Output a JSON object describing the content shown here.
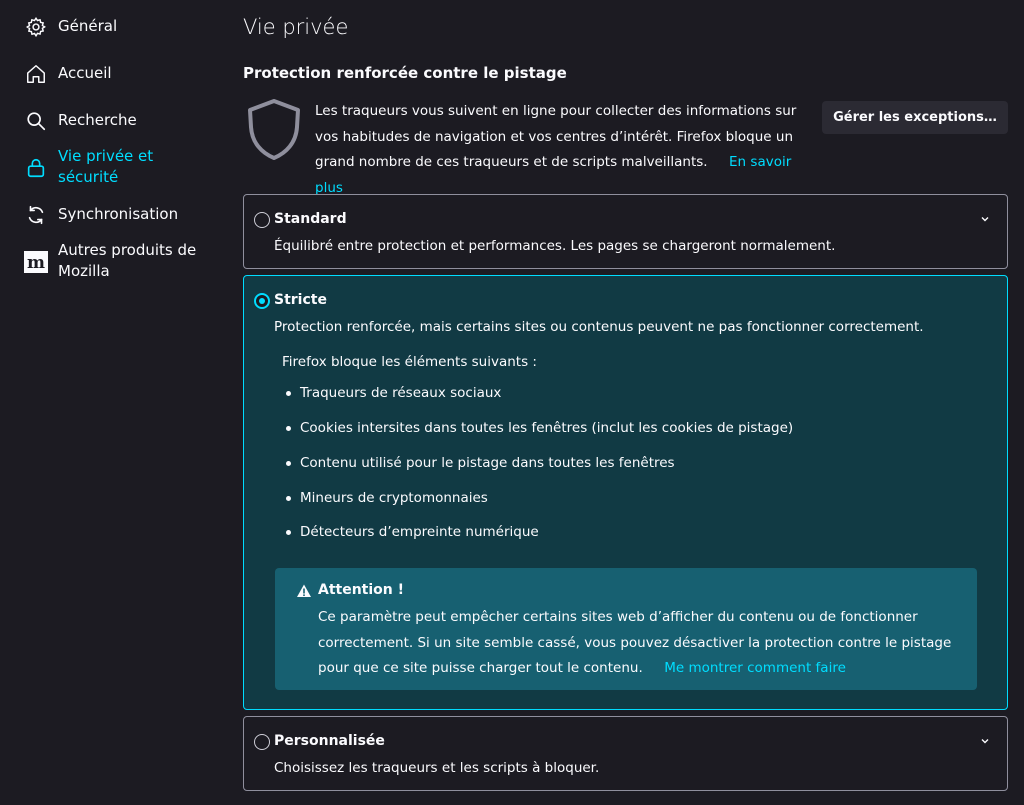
{
  "sidebar": {
    "items": [
      {
        "label": "Général",
        "icon": "gear-icon"
      },
      {
        "label": "Accueil",
        "icon": "home-icon"
      },
      {
        "label": "Recherche",
        "icon": "search-icon"
      },
      {
        "label": "Vie privée et sécurité",
        "icon": "lock-icon",
        "active": true
      },
      {
        "label": "Synchronisation",
        "icon": "sync-icon"
      },
      {
        "label": "Autres produits de Mozilla",
        "icon": "mozilla-logo-icon"
      }
    ]
  },
  "main": {
    "page_title": "Vie privée",
    "section_title": "Protection renforcée contre le pistage",
    "intro_text": "Les traqueurs vous suivent en ligne pour collecter des informations sur vos habitudes de navigation et vos centres d’intérêt. Firefox bloque un grand nombre de ces traqueurs et de scripts malveillants.",
    "learn_more": "En savoir plus",
    "exceptions_button": "Gérer les exceptions…"
  },
  "options": {
    "standard": {
      "title": "Standard",
      "description": "Équilibré entre protection et performances. Les pages se chargeront normalement.",
      "selected": false
    },
    "strict": {
      "title": "Stricte",
      "description": "Protection renforcée, mais certains sites ou contenus peuvent ne pas fonctionner correctement.",
      "selected": true,
      "blocks_heading": "Firefox bloque les éléments suivants :",
      "blocks": [
        "Traqueurs de réseaux sociaux",
        "Cookies intersites dans toutes les fenêtres (inclut les cookies de pistage)",
        "Contenu utilisé pour le pistage dans toutes les fenêtres",
        "Mineurs de cryptomonnaies",
        "Détecteurs d’empreinte numérique"
      ],
      "warning": {
        "title": "Attention !",
        "text": "Ce paramètre peut empêcher certains sites web d’afficher du contenu ou de fonctionner correctement. Si un site semble cassé, vous pouvez désactiver la protection contre le pistage pour que ce site puisse charger tout le contenu.",
        "link": "Me montrer comment faire"
      }
    },
    "custom": {
      "title": "Personnalisée",
      "description": "Choisissez les traqueurs et les scripts à bloquer.",
      "selected": false
    }
  },
  "colors": {
    "background": "#1c1b22",
    "accent": "#00ddff",
    "selected_card": "#113a44",
    "warning_box": "#176071",
    "button": "#2b2a33"
  }
}
